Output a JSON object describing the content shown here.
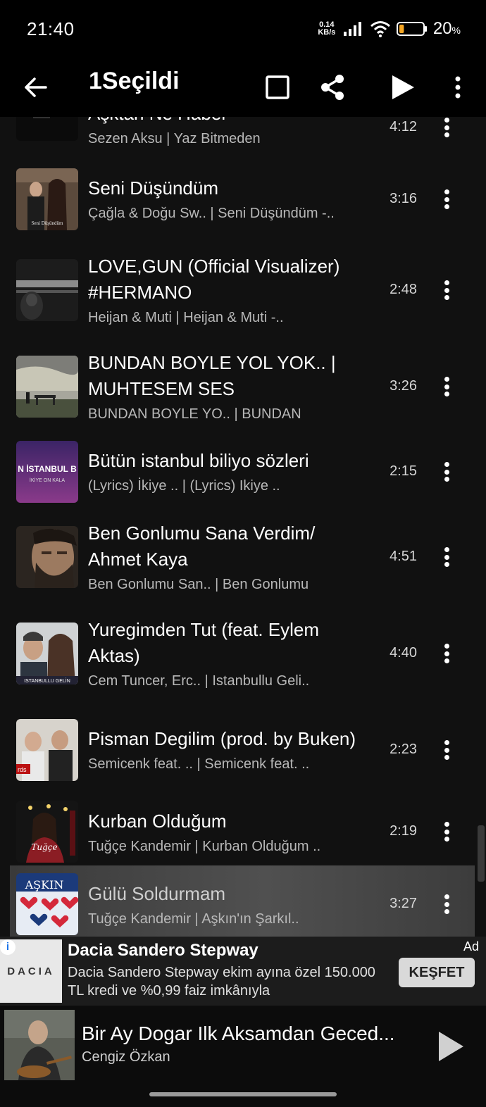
{
  "status_bar": {
    "time": "21:40",
    "net_speed_value": "0.14",
    "net_speed_unit": "KB/s",
    "battery_percent": "20",
    "battery_percent_sign": "%",
    "battery_level": 0.2,
    "battery_color": "#f5a623"
  },
  "header": {
    "title": "1Seçildi",
    "icons": [
      "back-arrow-icon",
      "select-all-checkbox-icon",
      "share-icon",
      "play-icon",
      "more-vert-icon"
    ]
  },
  "songs": [
    {
      "title": "Aşktan Ne Haber",
      "subtitle": "Sezen Aksu | Yaz Bitmeden",
      "duration": "4:12"
    },
    {
      "title": "Seni Düşündüm",
      "subtitle": "Çağla & Doğu Sw.. | Seni Düşündüm -..",
      "duration": "3:16"
    },
    {
      "title": "LOVE,GUN (Official Visualizer) #HERMANO",
      "subtitle": "Heijan & Muti | Heijan & Muti -..",
      "duration": "2:48"
    },
    {
      "title": "BUNDAN BOYLE YOL YOK.. | MUHTESEM SES",
      "subtitle": "BUNDAN BOYLE YO.. | BUNDAN",
      "duration": "3:26"
    },
    {
      "title": "Bütün istanbul biliyo sözleri",
      "subtitle": "(Lyrics) İkiye .. | (Lyrics) Ikiye ..",
      "duration": "2:15",
      "thumb_text": "N İSTANBUL B",
      "thumb_subtext": "İKİYE ON KALA"
    },
    {
      "title": "Ben Gonlumu Sana Verdim/ Ahmet Kaya",
      "subtitle": "Ben Gonlumu San.. | Ben Gonlumu",
      "duration": "4:51"
    },
    {
      "title": "Yuregimden Tut (feat. Eylem Aktas)",
      "subtitle": "Cem Tuncer, Erc.. | Istanbullu Geli..",
      "duration": "4:40"
    },
    {
      "title": "Pisman Degilim (prod. by Buken)",
      "subtitle": "Semicenk feat. .. | Semicenk feat. ..",
      "duration": "2:23"
    },
    {
      "title": "Kurban Olduğum",
      "subtitle": "Tuğçe Kandemir | Kurban Olduğum ..",
      "duration": "2:19"
    },
    {
      "title": "Gülü Soldurmam",
      "subtitle": "Tuğçe Kandemir | Aşkın'ın Şarkıl..",
      "duration": "3:27",
      "selected": true
    }
  ],
  "ad": {
    "brand_logo_text": "DACIA",
    "title": "Dacia Sandero Stepway",
    "body": "Dacia Sandero Stepway ekim ayına özel 150.000 TL kredi ve %0,99 faiz imkânıyla",
    "tag": "Ad",
    "cta": "KEŞFET"
  },
  "now_playing": {
    "title": "Bir Ay Dogar Ilk Aksamdan Geced...",
    "artist": "Cengiz Özkan"
  }
}
